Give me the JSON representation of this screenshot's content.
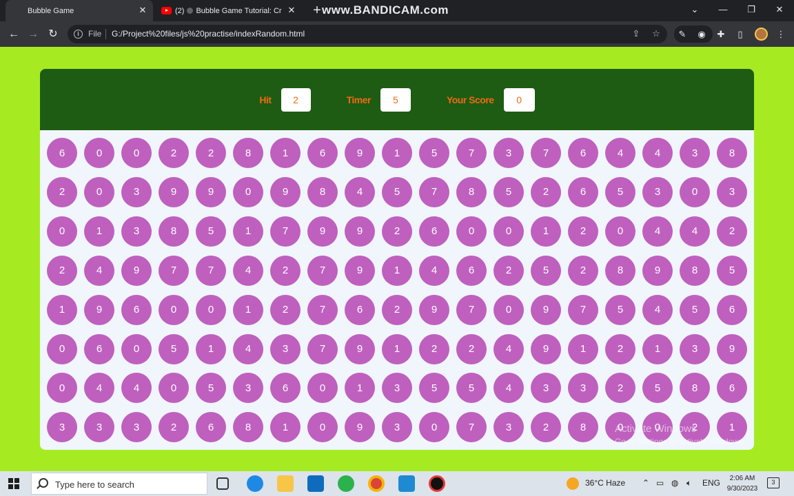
{
  "browser": {
    "tabs": [
      {
        "title": "Bubble Game",
        "active": true
      },
      {
        "title": "Bubble Game Tutorial: Cr",
        "count": "(2)",
        "active": false
      }
    ],
    "new_tab_label": "+",
    "watermark": "www.BANDICAM.com",
    "address": {
      "scheme": "File",
      "url": "G:/Project%20files/js%20practise/indexRandom.html"
    }
  },
  "game": {
    "hit_label": "Hit",
    "hit_value": "2",
    "timer_label": "Timer",
    "timer_value": "5",
    "score_label": "Your Score",
    "score_value": "0",
    "bubble_rows": [
      [
        6,
        0,
        0,
        2,
        2,
        8,
        1,
        6,
        9,
        1,
        5,
        7,
        3,
        7,
        6,
        4,
        4,
        3,
        8
      ],
      [
        2,
        0,
        3,
        9,
        9,
        0,
        9,
        8,
        4,
        5,
        7,
        8,
        5,
        2,
        6,
        5,
        3,
        0,
        3
      ],
      [
        0,
        1,
        3,
        8,
        5,
        1,
        7,
        9,
        9,
        2,
        6,
        0,
        0,
        1,
        2,
        0,
        4,
        4,
        2
      ],
      [
        2,
        4,
        9,
        7,
        7,
        4,
        2,
        7,
        9,
        1,
        4,
        6,
        2,
        5,
        2,
        8,
        9,
        8,
        5
      ],
      [
        1,
        9,
        6,
        0,
        0,
        1,
        2,
        7,
        6,
        2,
        9,
        7,
        0,
        9,
        7,
        5,
        4,
        5,
        6
      ],
      [
        0,
        6,
        0,
        5,
        1,
        4,
        3,
        7,
        9,
        1,
        2,
        2,
        4,
        9,
        1,
        2,
        1,
        3,
        9
      ],
      [
        0,
        4,
        4,
        0,
        5,
        3,
        6,
        0,
        1,
        3,
        5,
        5,
        4,
        3,
        3,
        2,
        5,
        8,
        6
      ],
      [
        3,
        3,
        3,
        2,
        6,
        8,
        1,
        0,
        9,
        3,
        0,
        7,
        3,
        2,
        8,
        0,
        0,
        2,
        1
      ]
    ],
    "colors": {
      "page_bg": "#a6eb22",
      "panel_top": "#1d5c12",
      "bubble": "#bf60bf",
      "accent": "#f06a10"
    }
  },
  "overlay": {
    "activate_title": "Activate Windows",
    "activate_sub": "Go to Settings to activate Windows."
  },
  "taskbar": {
    "search_placeholder": "Type here to search",
    "weather": "36°C  Haze",
    "language": "ENG",
    "time": "2:06 AM",
    "date": "9/30/2023",
    "notification_count": "3"
  }
}
